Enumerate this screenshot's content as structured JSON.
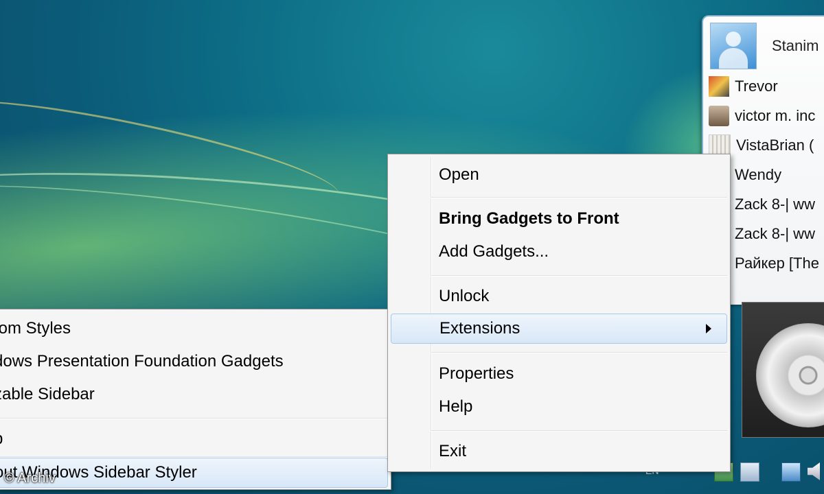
{
  "sidebar": {
    "profile_name": "Stanim",
    "contacts": [
      {
        "name": "Trevor"
      },
      {
        "name": "victor m. inc"
      },
      {
        "name": "VistaBrian ("
      },
      {
        "name": "Wendy"
      },
      {
        "name": "Zack 8-| ww"
      },
      {
        "name": "Zack 8-| ww"
      },
      {
        "name": "Райкер [The"
      }
    ]
  },
  "context_menu": {
    "open": "Open",
    "bring_to_front": "Bring Gadgets to Front",
    "add_gadgets": "Add Gadgets...",
    "unlock": "Unlock",
    "extensions": "Extensions",
    "properties": "Properties",
    "help": "Help",
    "exit": "Exit"
  },
  "extensions_submenu": {
    "custom_styles": "tom Styles",
    "wpf_gadgets": "dows Presentation Foundation Gadgets",
    "sizable_sidebar": "zable Sidebar",
    "help": "p",
    "about": "out Windows Sidebar Styler"
  },
  "tray": {
    "language": "EN"
  },
  "watermark": "© Archiv"
}
